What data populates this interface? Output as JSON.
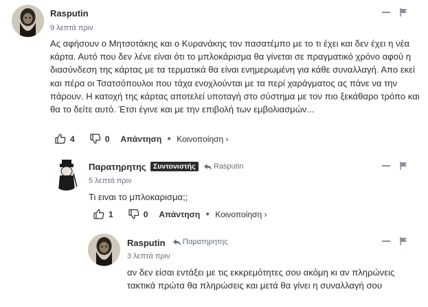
{
  "comments": [
    {
      "author": "Rasputin",
      "time": "9 λεπτά πριν",
      "text": "Ας αφήσουν ο Μητσοτάκης και ο Κυρανάκης τον πασατέμπο με το τι έχει και δεν έχει η νέα κάρτα. Αυτό που δεν λένε είναι ότι το μπλοκάρισμα θα γίνεται σε πραγματικό χρόνο αφού η διασύνδεση της κάρτας με τα τερματικά θα είναι ενημερωμένη για κάθε συναλλαγή. Απο εκεί και πέρα οι Τσατσόπουλοι που τάχα ενοχλούνται με τα περί χαράγματος ας πάνε να την πάρουν. Η κατοχή της κάρτας αποτελεί υποταγή στο σύστημα με τον πιο ξεκάθαρο τρόπο και θα το δείτε αυτό. Έτσι έγινε και με την επιβολή των εμβολιασμών...",
      "likes": "4",
      "dislikes": "0",
      "reply_label": "Απάντηση",
      "share_label": "Κοινοποίηση ›"
    },
    {
      "author": "Παρατηρητης",
      "badge": "Συντονιστής",
      "reply_to": "Rasputin",
      "time": "5 λεπτά πριν",
      "text": "Τι ειναι το μπλοκαρισμα;;",
      "likes": "1",
      "dislikes": "0",
      "reply_label": "Απάντηση",
      "share_label": "Κοινοποίηση ›"
    },
    {
      "author": "Rasputin",
      "reply_to": "Παρατηρητης",
      "time": "3 λεπτά πριν",
      "text": "αν δεν είσαι εντάξει με τις εκκρεμότητες σου ακόμη κι αν πληρώνεις τακτικά πρώτα θα πληρώσεις και μετά θα γίνει η συναλλαγή σου"
    }
  ],
  "colors": {
    "text": "#2a2e2e",
    "muted": "#656c7a",
    "badge_bg": "#2a2e2e"
  }
}
